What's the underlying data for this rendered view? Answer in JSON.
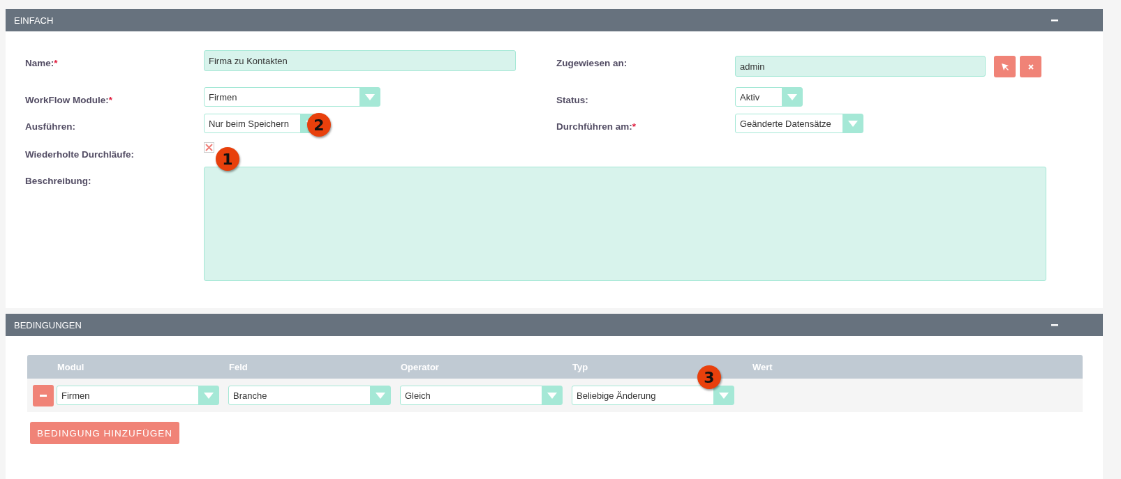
{
  "sections": [
    {
      "title": "EINFACH",
      "expanded": true,
      "rows": [
        {
          "left": {
            "label": "Name:",
            "required_mark": "*",
            "kind": "text",
            "value": "Firma zu Kontakten"
          },
          "right": {
            "label": "Zugewiesen an:",
            "kind": "relate",
            "value": "admin"
          }
        },
        {
          "left": {
            "label": "WorkFlow Module:",
            "required_mark": "*",
            "kind": "select",
            "value": "Firmen"
          },
          "right": {
            "label": "Status:",
            "kind": "select",
            "value": "Aktiv"
          }
        },
        {
          "left": {
            "label": "Ausführen:",
            "kind": "select",
            "value": "Nur beim Speichern",
            "callout": "2"
          },
          "right": {
            "label": "Durchführen am:",
            "required_mark": "*",
            "kind": "select",
            "value": "Geänderte Datensätze"
          }
        },
        {
          "left": {
            "label": "Wiederholte Durchläufe:",
            "kind": "checkbox",
            "checked": true,
            "callout": "1"
          }
        },
        {
          "left": {
            "label": "Beschreibung:",
            "kind": "textarea"
          }
        }
      ]
    },
    {
      "title": "BEDINGUNGEN",
      "expanded": true,
      "conditions": {
        "columns": [
          "Modul",
          "Feld",
          "Operator",
          "Typ",
          "Wert"
        ],
        "rows": [
          {
            "cells": [
              {
                "value": "Firmen"
              },
              {
                "value": "Branche"
              },
              {
                "value": "Gleich"
              },
              {
                "value": "Beliebige Änderung",
                "callout": "3"
              }
            ]
          }
        ]
      },
      "add_button": "BEDINGUNG HINZUFÜGEN"
    }
  ]
}
